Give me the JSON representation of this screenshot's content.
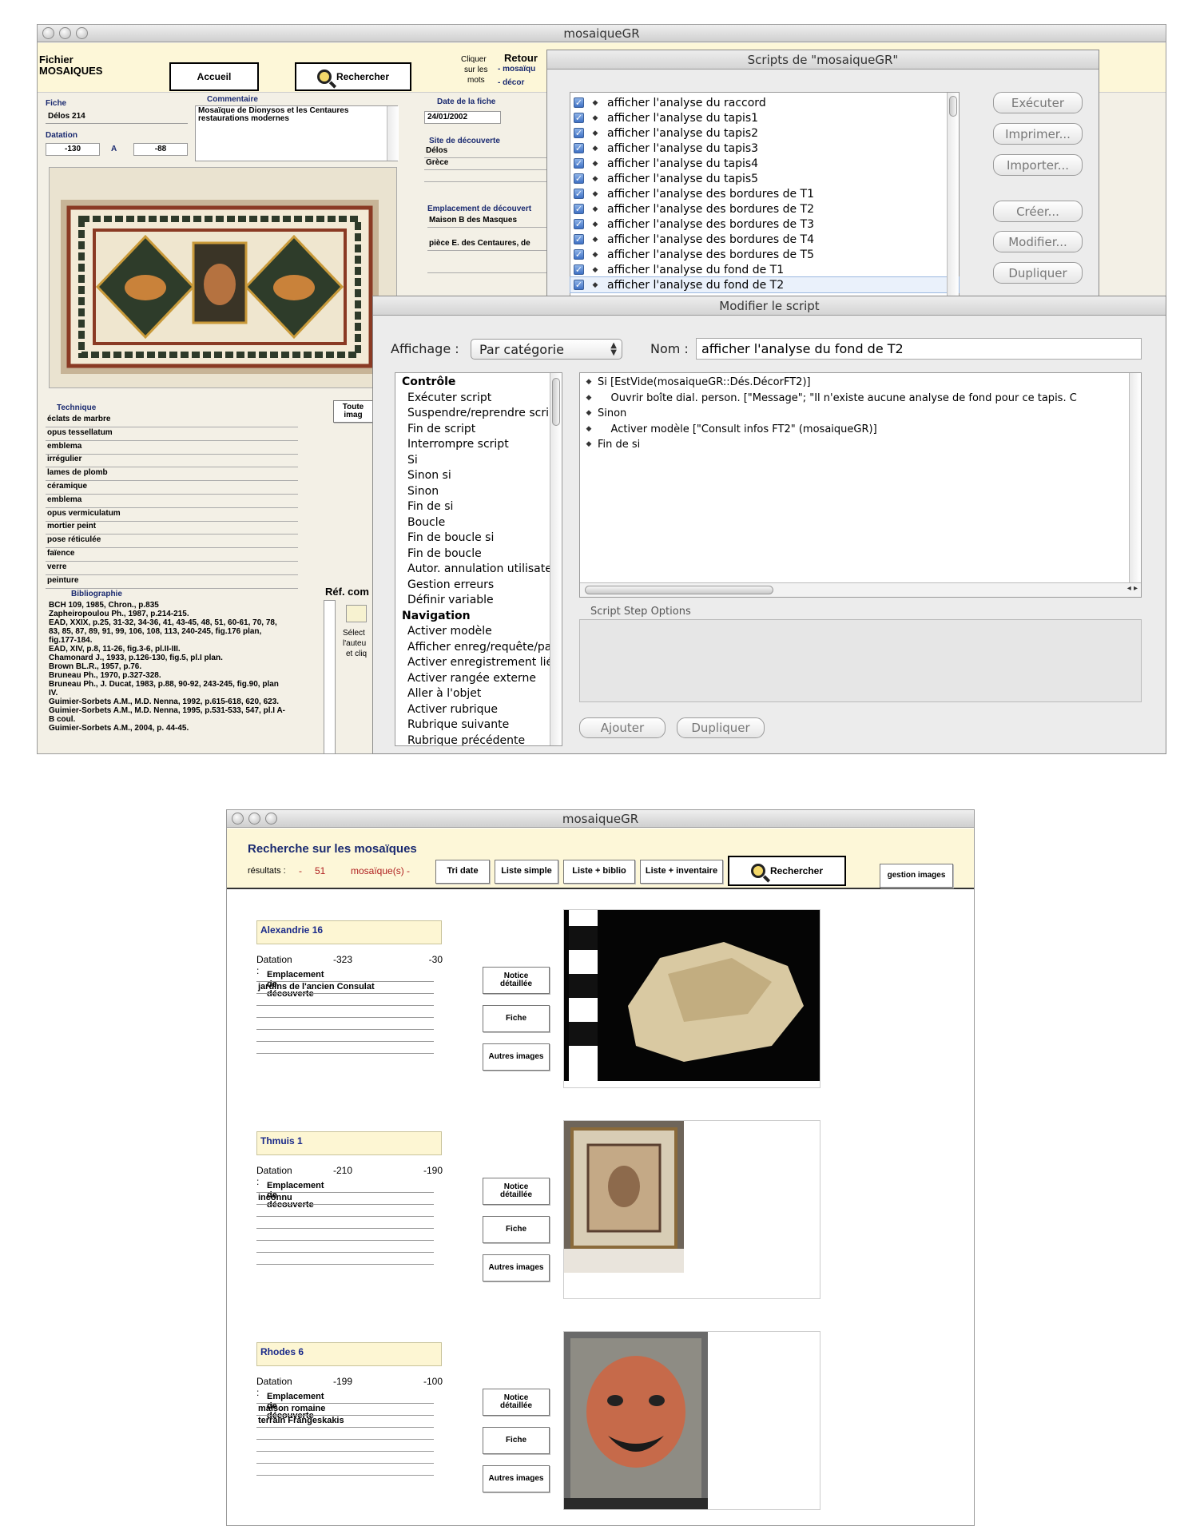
{
  "top_window": {
    "title": "mosaiqueGR",
    "header": {
      "file_label": "Fichier",
      "file_name": "MOSAIQUES",
      "home_button": "Accueil",
      "search_button": "Rechercher",
      "click_hint": [
        "Cliquer",
        "sur les",
        "mots"
      ],
      "return_label": "Retour",
      "return_links": [
        "- mosaïqu",
        "- décor"
      ]
    },
    "record": {
      "fiche_label": "Fiche",
      "fiche_value": "Délos 214",
      "comment_label": "Commentaire",
      "comment_text": "Mosaïque de Dionysos et les Centaures\nrestaurations modernes",
      "dating_label": "Datation",
      "date_from": "-130",
      "date_sep": "A",
      "date_to": "-88",
      "card_date_label": "Date de la fiche",
      "card_date": "24/01/2002",
      "site_label": "Site de découverte",
      "site_values": [
        "Délos",
        "Grèce"
      ],
      "location_label": "Emplacement de découvert",
      "location_values": [
        "Maison B des Masques",
        "pièce E. des Centaures, de"
      ],
      "technique_label": "Technique",
      "techniques": [
        "éclats de marbre",
        "opus tessellatum",
        "emblema",
        "irrégulier",
        "lames de plomb",
        "céramique",
        "emblema",
        "opus vermiculatum",
        "mortier peint",
        "pose réticulée",
        "faïence",
        "verre",
        "peinture"
      ],
      "all_images_button": "Toute\nimag",
      "bibliography_label": "Bibliographie",
      "bibliography": "BCH 109, 1985, Chron., p.835\nZapheiropoulou Ph., 1987, p.214-215.\nEAD, XXIX, p.25, 31-32, 34-36, 41, 43-45, 48, 51, 60-61, 70, 78,\n83, 85, 87, 89, 91, 99, 106, 108, 113, 240-245, fig.176 plan,\nfig.177-184.\nEAD, XIV, p.8, 11-26, fig.3-6, pl.II-III.\nChamonard J., 1933, p.126-130, fig.5, pl.I plan.\nBrown BL.R., 1957, p.76.\nBruneau Ph., 1970, p.327-328.\nBruneau Ph., J. Ducat, 1983, p.88, 90-92, 243-245, fig.90, plan\nIV.\nGuimier-Sorbets A.M., M.D. Nenna, 1992, p.615-618, 620, 623.\nGuimier-Sorbets A.M., M.D. Nenna, 1995, p.531-533, 547, pl.I A-\nB coul.\nGuimier-Sorbets A.M., 2004, p. 44-45.",
      "ref_label": "Réf. com",
      "ref_hint": [
        "Sélect",
        "l'auteu",
        "et cliq"
      ]
    }
  },
  "scripts_dialog": {
    "title": "Scripts de \"mosaiqueGR\"",
    "scripts": [
      "afficher l'analyse du raccord",
      "afficher l'analyse du tapis1",
      "afficher l'analyse du tapis2",
      "afficher l'analyse du tapis3",
      "afficher l'analyse du tapis4",
      "afficher l'analyse du tapis5",
      "afficher l'analyse des bordures de T1",
      "afficher l'analyse des bordures de T2",
      "afficher l'analyse des bordures de T3",
      "afficher l'analyse des bordures de T4",
      "afficher l'analyse des bordures de T5",
      "afficher l'analyse du fond de T1",
      "afficher l'analyse du fond de T2"
    ],
    "buttons": {
      "execute": "Exécuter",
      "print": "Imprimer...",
      "import": "Importer...",
      "create": "Créer...",
      "modify": "Modifier...",
      "duplicate": "Dupliquer"
    }
  },
  "edit_dialog": {
    "title": "Modifier le script",
    "view_label": "Affichage :",
    "view_value": "Par catégorie",
    "name_label": "Nom :",
    "name_value": "afficher l'analyse du fond de T2",
    "steps": [
      {
        "text": "Contrôle",
        "header": true
      },
      {
        "text": "Exécuter script"
      },
      {
        "text": "Suspendre/reprendre script"
      },
      {
        "text": "Fin de script"
      },
      {
        "text": "Interrompre script"
      },
      {
        "text": "Si"
      },
      {
        "text": "Sinon si"
      },
      {
        "text": "Sinon"
      },
      {
        "text": "Fin de si"
      },
      {
        "text": "Boucle"
      },
      {
        "text": "Fin de boucle si"
      },
      {
        "text": "Fin de boucle"
      },
      {
        "text": "Autor. annulation utilisateur"
      },
      {
        "text": "Gestion erreurs"
      },
      {
        "text": "Définir variable"
      },
      {
        "text": "Navigation",
        "header": true
      },
      {
        "text": "Activer modèle"
      },
      {
        "text": "Afficher enreg/requête/page"
      },
      {
        "text": "Activer enregistrement lié"
      },
      {
        "text": "Activer rangée externe"
      },
      {
        "text": "Aller à l'objet"
      },
      {
        "text": "Activer rubrique"
      },
      {
        "text": "Rubrique suivante"
      },
      {
        "text": "Rubrique précédente"
      }
    ],
    "script_lines": [
      "Si [EstVide(mosaiqueGR::Dés.DécorFT2)]",
      "    Ouvrir boîte dial. person. [\"Message\"; \"Il n'existe aucune analyse de fond pour ce tapis. C",
      "Sinon",
      "    Activer modèle [\"Consult infos FT2\" (mosaiqueGR)]",
      "Fin de si"
    ],
    "options_label": "Script Step Options",
    "add_button": "Ajouter",
    "dup_button": "Dupliquer"
  },
  "bottom_window": {
    "title": "mosaiqueGR",
    "heading": "Recherche sur les mosaïques",
    "results_label": "résultats :",
    "results_dash": "-",
    "results_count": "51",
    "results_unit": "mosaïque(s) -",
    "toolbar": [
      "Tri date",
      "Liste simple",
      "Liste + biblio",
      "Liste + inventaire"
    ],
    "search_button": "Rechercher",
    "images_button": "gestion images",
    "dating_label": "Datation :",
    "location_label": "Emplacement de découverte",
    "btn_notice": "Notice\ndétaillée",
    "btn_fiche": "Fiche",
    "btn_images": "Autres images",
    "records": [
      {
        "name": "Alexandrie 16",
        "date_from": "-323",
        "date_to": "-30",
        "locations": [
          "jardins de l'ancien Consulat"
        ]
      },
      {
        "name": "Thmuis 1",
        "date_from": "-210",
        "date_to": "-190",
        "locations": [
          "inconnu"
        ]
      },
      {
        "name": "Rhodes 6",
        "date_from": "-199",
        "date_to": "-100",
        "locations": [
          "maison romaine",
          "terrain Frangeskakis"
        ]
      }
    ]
  }
}
